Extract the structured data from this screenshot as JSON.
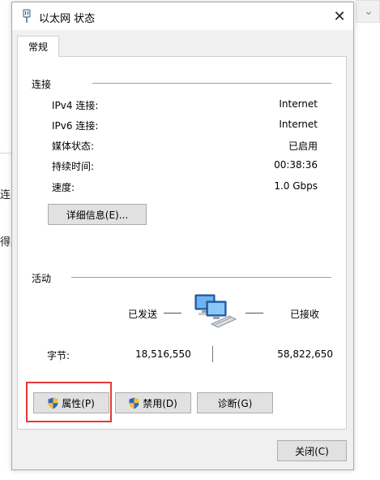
{
  "background": {
    "fragments": [
      "连",
      "得属"
    ]
  },
  "dialog": {
    "title": "以太网 状态",
    "close_glyph": "✕",
    "tab_label": "常规",
    "connection": {
      "section_label": "连接",
      "rows": [
        {
          "label": "IPv4 连接:",
          "value": "Internet"
        },
        {
          "label": "IPv6 连接:",
          "value": "Internet"
        },
        {
          "label": "媒体状态:",
          "value": "已启用"
        },
        {
          "label": "持续时间:",
          "value": "00:38:36"
        },
        {
          "label": "速度:",
          "value": "1.0 Gbps"
        }
      ],
      "details_button": "详细信息(E)..."
    },
    "activity": {
      "section_label": "活动",
      "sent_label": "已发送",
      "received_label": "已接收",
      "bytes_label": "字节:",
      "bytes_sent": "18,516,550",
      "bytes_received": "58,822,650"
    },
    "buttons": {
      "properties": "属性(P)",
      "disable": "禁用(D)",
      "diagnose": "诊断(G)",
      "close": "关闭(C)"
    },
    "highlight_color": "#e53935"
  }
}
